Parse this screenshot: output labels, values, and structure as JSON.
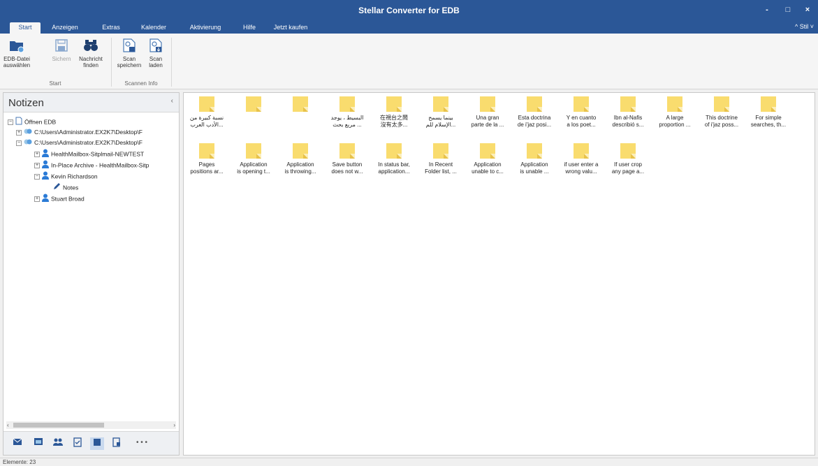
{
  "window": {
    "title": "Stellar Converter for EDB",
    "minimize": "-",
    "maximize": "□",
    "close": "×"
  },
  "tabs": [
    "Start",
    "Anzeigen",
    "Extras",
    "Kalender",
    "Aktivierung",
    "Hilfe",
    "Jetzt kaufen"
  ],
  "stil_label": "^ Stil ˅",
  "ribbon": {
    "buttons": [
      {
        "l1": "EDB-Datei",
        "l2": "auswählen"
      },
      {
        "l1": "Sichern",
        "l2": ""
      },
      {
        "l1": "Nachricht",
        "l2": "finden"
      },
      {
        "l1": "Scan",
        "l2": "speichern"
      },
      {
        "l1": "Scan",
        "l2": "laden"
      }
    ],
    "groups": [
      "Start",
      "Scannen Info"
    ]
  },
  "left_panel": {
    "title": "Notizen",
    "tree": [
      {
        "toggle": "−",
        "label": "Öffnen EDB"
      },
      {
        "toggle": "+",
        "label": "C:\\Users\\Administrator.EX2K7\\Desktop\\F"
      },
      {
        "toggle": "−",
        "label": "C:\\Users\\Administrator.EX2K7\\Desktop\\F"
      },
      {
        "toggle": "+",
        "label": "HealthMailbox-Sitplmail-NEWTEST"
      },
      {
        "toggle": "+",
        "label": "In-Place Archive - HealthMailbox-Sitp"
      },
      {
        "toggle": "−",
        "label": "Kevin Richardson"
      },
      {
        "toggle": "",
        "label": "Notes"
      },
      {
        "toggle": "+",
        "label": "Stuart Broad"
      }
    ]
  },
  "notes": [
    {
      "l1": "نسبة كبيرة من",
      "l2": "الأدب العرب..."
    },
    {
      "l1": "",
      "l2": ""
    },
    {
      "l1": "",
      "l2": ""
    },
    {
      "l1": "البسيط ، يوجد",
      "l2": "مربع بحث ..."
    },
    {
      "l1": "在視台之鬧",
      "l2": "沒有太多..."
    },
    {
      "l1": "بينما يسمح",
      "l2": "الإسلام للم..."
    },
    {
      "l1": "Una gran",
      "l2": "parte de la ..."
    },
    {
      "l1": "Esta doctrina",
      "l2": "de i'jaz posi..."
    },
    {
      "l1": "Y en cuanto",
      "l2": "a los poet..."
    },
    {
      "l1": "Ibn al-Nafis",
      "l2": "describió s..."
    },
    {
      "l1": "A large",
      "l2": "proportion ..."
    },
    {
      "l1": "This doctrine",
      "l2": "of i'jaz poss..."
    },
    {
      "l1": "For simple",
      "l2": "searches, th..."
    },
    {
      "l1": "Pages",
      "l2": "positions ar..."
    },
    {
      "l1": "Application",
      "l2": "is opening t..."
    },
    {
      "l1": "Application",
      "l2": "is throwing..."
    },
    {
      "l1": "Save button",
      "l2": "does not w..."
    },
    {
      "l1": "In status bar,",
      "l2": "application..."
    },
    {
      "l1": "In Recent",
      "l2": "Folder list, ..."
    },
    {
      "l1": "Application",
      "l2": "unable to c..."
    },
    {
      "l1": "Application",
      "l2": "is unable ..."
    },
    {
      "l1": "if user enter a",
      "l2": "wrong valu..."
    },
    {
      "l1": "If user crop",
      "l2": "any page a..."
    }
  ],
  "status": {
    "text": "Elemente: 23"
  },
  "colors": {
    "titlebar": "#2b5797",
    "note": "#f9dc6e",
    "person": "#2b7bd6"
  },
  "icons": {
    "nav": [
      "mail-icon",
      "calendar-icon",
      "contacts-icon",
      "tasks-icon",
      "notes-icon",
      "journal-icon",
      "more-icon"
    ],
    "more_label": "• • •"
  }
}
